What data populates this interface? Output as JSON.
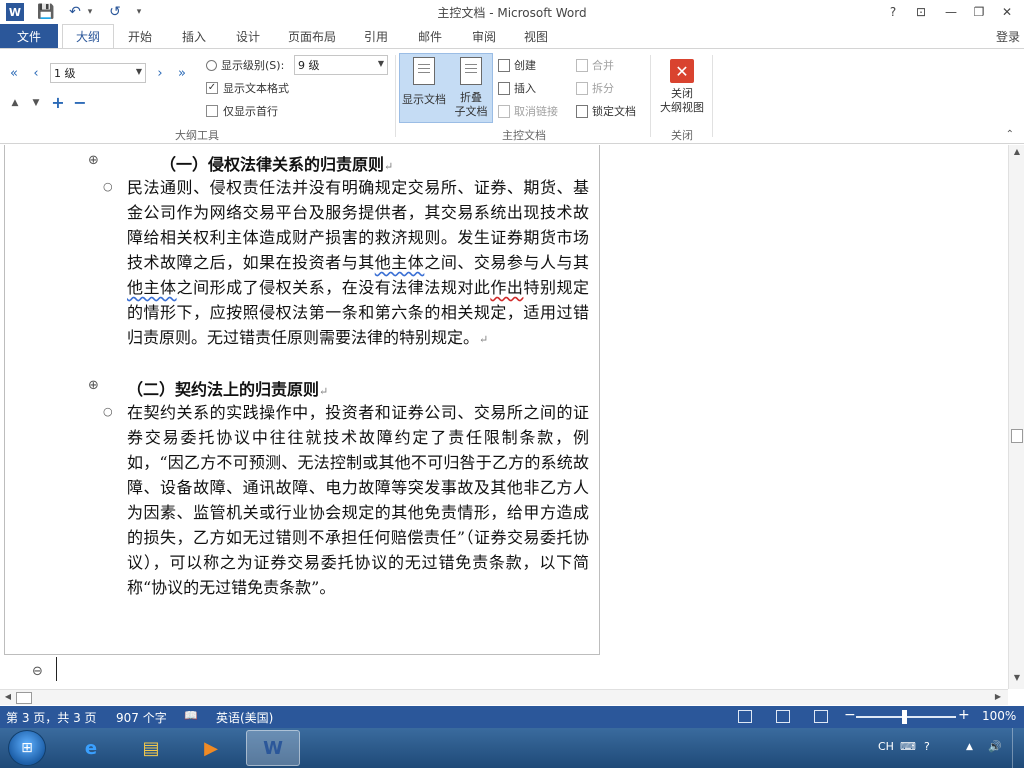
{
  "window": {
    "title": "主控文档 - Microsoft Word",
    "help": "?",
    "ribbon_display": "⊡",
    "minimize": "—",
    "restore": "❐",
    "close": "✕"
  },
  "quick_access": {
    "app_icon": "W",
    "save": "💾",
    "undo": "↶",
    "undo_dd": "▾",
    "redo": "↺",
    "customize": "▾"
  },
  "tabs": {
    "file": "文件",
    "items": [
      "大纲",
      "开始",
      "插入",
      "设计",
      "页面布局",
      "引用",
      "邮件",
      "审阅",
      "视图"
    ],
    "active": "大纲",
    "login": "登录"
  },
  "ribbon": {
    "outline_tools": {
      "label": "大纲工具",
      "promote_heading": "«",
      "promote": "‹",
      "level_value": "1 级",
      "demote": "›",
      "demote_body": "»",
      "move_up": "▲",
      "move_down": "▼",
      "expand": "+",
      "collapse": "−",
      "show_level_label": "显示级别(S):",
      "show_level_value": "9 级",
      "show_text_format": "显示文本格式",
      "show_text_format_checked": "✓",
      "show_first_line": "仅显示首行"
    },
    "master_document": {
      "label": "主控文档",
      "show_document": "显示文档",
      "collapse_line1": "折叠",
      "collapse_line2": "子文档",
      "create": "创建",
      "insert": "插入",
      "unlink": "取消链接",
      "merge": "合并",
      "split": "拆分",
      "lock": "锁定文档"
    },
    "close_group": {
      "label": "关闭",
      "close_icon": "✕",
      "close_line1": "关闭",
      "close_line2": "大纲视图"
    },
    "collapse_ribbon": "⌃"
  },
  "document": {
    "plus_symbol": "⊕",
    "body_symbol": "○",
    "minus_symbol": "⊖",
    "para_mark": "↵",
    "heading1": "（一）侵权法律关系的归责原则",
    "para1_parts": [
      "民法通则、侵权责任法并没有明确规定交易所、证券、期货、基金公司作为网络交易平台及服务提供者，其交易系统出现技术故障给相关权利主体造成财产损害的救济规则。发生证券期货市场技术故障之后，如果在投资者与其",
      "他主体",
      "之间、交易参与人与其",
      "他主体",
      "之间形成了侵权关系，在没有法律法规对此",
      "作出",
      "特别规定的情形下，应按照侵权法第一条和第六条的相关规定，适用过错归责原则。无过错责任原则需要法律的特别规定。"
    ],
    "heading2": "（二）契约法上的归责原则",
    "para2": "在契约关系的实践操作中，投资者和证券公司、交易所之间的证券交易委托协议中往往就技术故障约定了责任限制条款，例如，“因乙方不可预测、无法控制或其他不可归咎于乙方的系统故障、设备故障、通讯故障、电力故障等突发事故及其他非乙方人为因素、监管机关或行业协会规定的其他免责情形，给甲方造成的损失，乙方如无过错则不承担任何赔偿责任”（证券交易委托协议），可以称之为证券交易委托协议的无过错免责条款，以下简称“协议的无过错免责条款”。"
  },
  "scroll": {
    "up": "▲",
    "down": "▼",
    "left": "◀",
    "right": "▶"
  },
  "status": {
    "page": "第 3 页，共 3 页",
    "words": "907 个字",
    "proof_icon": "📖",
    "language": "英语(美国)",
    "zoom_minus": "−",
    "zoom_plus": "+",
    "zoom": "100%"
  },
  "taskbar": {
    "start": "⊞",
    "apps": [
      {
        "name": "internet-explorer",
        "glyph": "e",
        "color": "#3aa0ff"
      },
      {
        "name": "file-explorer",
        "glyph": "▤",
        "color": "#f2c94c"
      },
      {
        "name": "media-player",
        "glyph": "▶",
        "color": "#f08a24"
      },
      {
        "name": "word",
        "glyph": "W",
        "color": "#2b579a"
      }
    ],
    "tray": {
      "lang": "CH",
      "keyboard": "⌨",
      "help": "?",
      "arrow": "▲",
      "volume": "🔊"
    }
  }
}
